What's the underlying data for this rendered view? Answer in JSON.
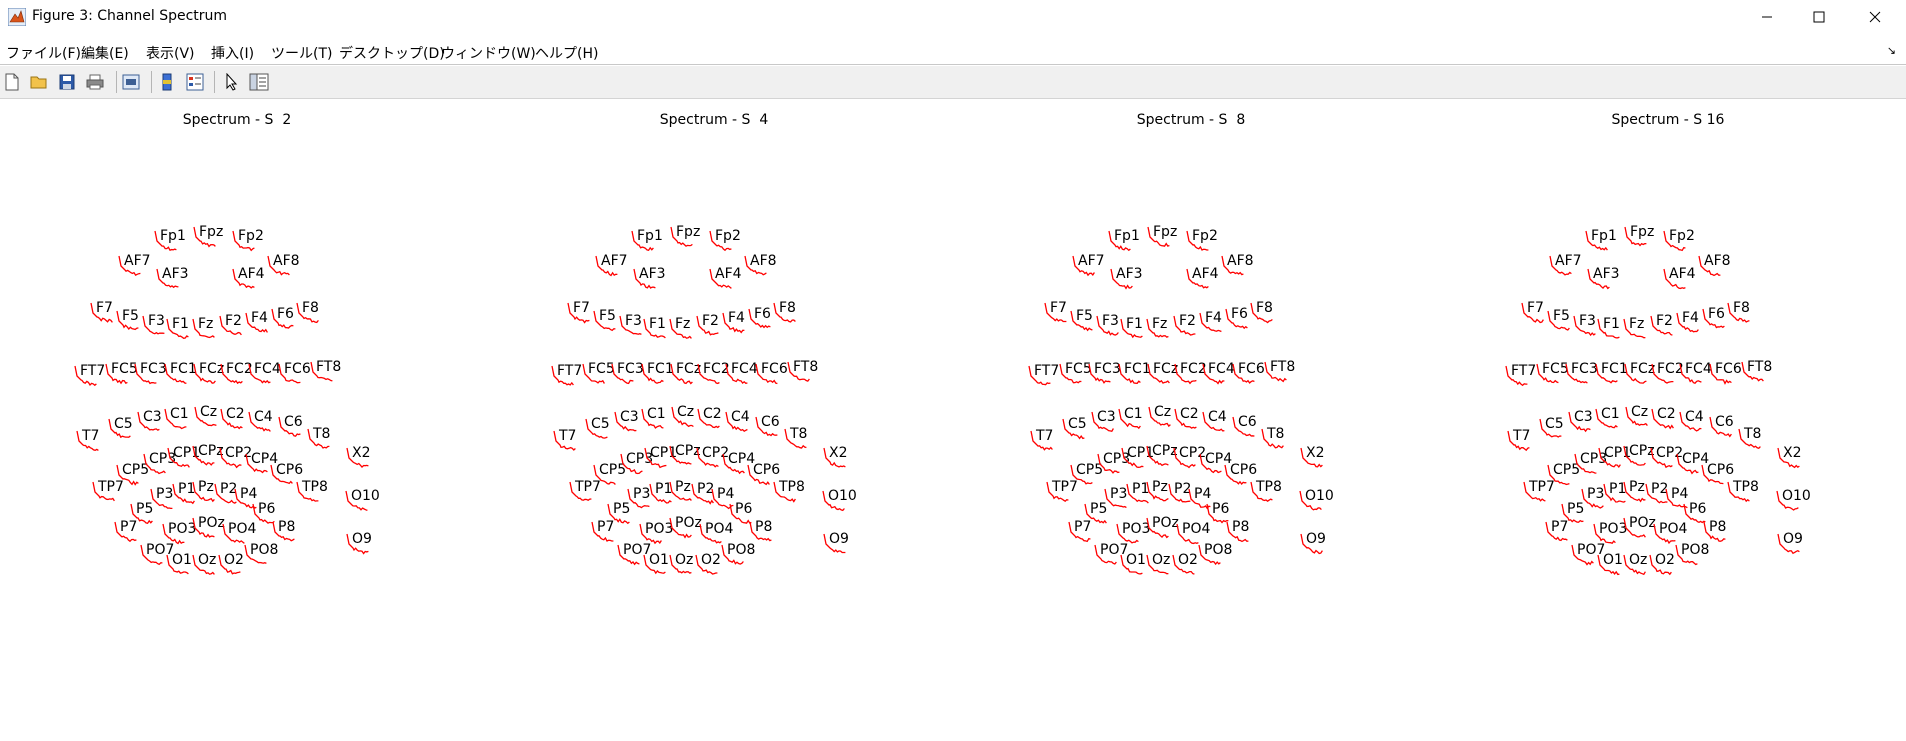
{
  "window": {
    "title": "Figure 3: Channel Spectrum",
    "minimize_icon": "minimize-icon",
    "maximize_icon": "maximize-icon",
    "close_icon": "close-icon"
  },
  "menu": [
    "ファイル(F)",
    "編集(E)",
    "表示(V)",
    "挿入(I)",
    "ツール(T)",
    "デスクトップ(D)",
    "ウィンドウ(W)",
    "ヘルプ(H)"
  ],
  "toolbar_icons": [
    "new-figure-icon",
    "open-file-icon",
    "save-icon",
    "print-icon",
    "print-preview-icon",
    "colorbar-icon",
    "legend-icon",
    "pointer-icon",
    "property-inspector-icon"
  ],
  "trace_color": "#ff0000",
  "plots": [
    {
      "title": "Spectrum - S  2"
    },
    {
      "title": "Spectrum - S  4"
    },
    {
      "title": "Spectrum - S  8"
    },
    {
      "title": "Spectrum - S 16"
    }
  ],
  "channels": [
    "Fp1",
    "Fpz",
    "Fp2",
    "AF7",
    "AF3",
    "AF4",
    "AF8",
    "F7",
    "F5",
    "F3",
    "F1",
    "Fz",
    "F2",
    "F4",
    "F6",
    "F8",
    "FT7",
    "FC5",
    "FC3",
    "FC1",
    "FCz",
    "FC2",
    "FC4",
    "FC6",
    "FT8",
    "T7",
    "C5",
    "C3",
    "C1",
    "Cz",
    "C2",
    "C4",
    "C6",
    "T8",
    "X2",
    "CP5",
    "CP3",
    "CP1",
    "CPz",
    "CP2",
    "CP4",
    "CP6",
    "TP7",
    "P3",
    "P1",
    "Pz",
    "P2",
    "P4",
    "TP8",
    "O10",
    "P5",
    "P6",
    "P7",
    "PO3",
    "POz",
    "PO4",
    "P8",
    "O9",
    "PO7",
    "PO8",
    "O1",
    "Oz",
    "O2"
  ]
}
